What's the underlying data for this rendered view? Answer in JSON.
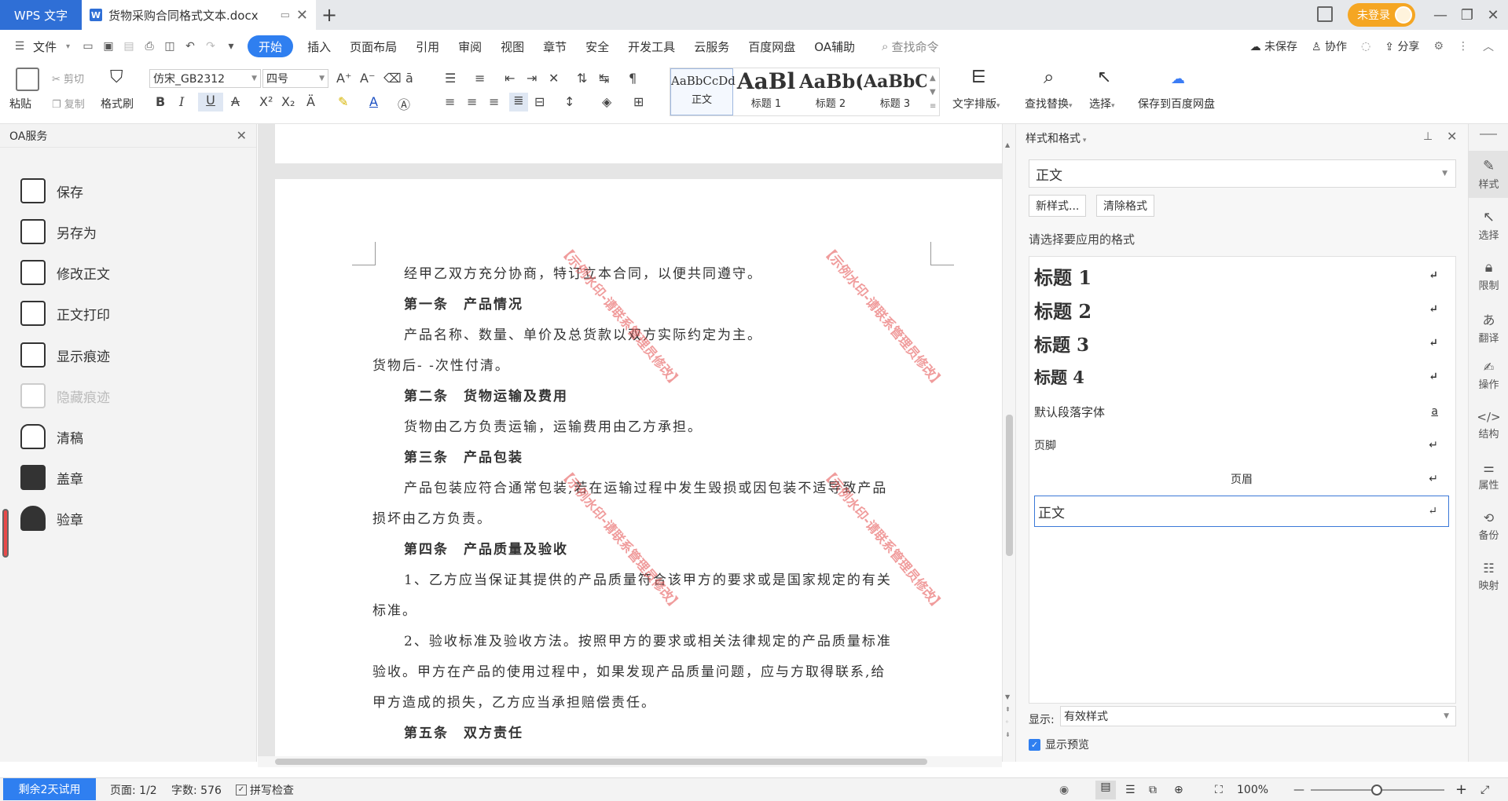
{
  "titlebar": {
    "app_name": "WPS 文字",
    "doc_tab": "货物采购合同格式文本.docx",
    "login": "未登录",
    "doc_icon_letter": "W"
  },
  "menu": {
    "file": "文件",
    "tabs": [
      "开始",
      "插入",
      "页面布局",
      "引用",
      "审阅",
      "视图",
      "章节",
      "安全",
      "开发工具",
      "云服务",
      "百度网盘",
      "OA辅助"
    ],
    "search_placeholder": "查找命令",
    "unsaved": "未保存",
    "collab": "协作",
    "share": "分享"
  },
  "ribbon": {
    "paste": "粘贴",
    "cut": "剪切",
    "copy": "复制",
    "format_painter": "格式刷",
    "font_name": "仿宋_GB2312",
    "font_size": "四号",
    "style_gallery": [
      {
        "preview": "AaBbCcDd",
        "label": "正文"
      },
      {
        "preview": "AaBl",
        "label": "标题 1"
      },
      {
        "preview": "AaBb(",
        "label": "标题 2"
      },
      {
        "preview": "AaBbC",
        "label": "标题 3"
      }
    ],
    "text_layout": "文字排版",
    "find_replace": "查找替换",
    "select": "选择",
    "save_baidu": "保存到百度网盘"
  },
  "oa_panel": {
    "title": "OA服务",
    "items": [
      {
        "label": "保存",
        "disabled": false
      },
      {
        "label": "另存为",
        "disabled": false
      },
      {
        "label": "修改正文",
        "disabled": false
      },
      {
        "label": "正文打印",
        "disabled": false
      },
      {
        "label": "显示痕迹",
        "disabled": false
      },
      {
        "label": "隐藏痕迹",
        "disabled": true
      },
      {
        "label": "清稿",
        "disabled": false
      },
      {
        "label": "盖章",
        "disabled": false
      },
      {
        "label": "验章",
        "disabled": false
      }
    ]
  },
  "document": {
    "lines": [
      {
        "text": "经甲乙双方充分协商，特订立本合同，以便共同遵守。",
        "bold": false,
        "indent": true
      },
      {
        "text": "第一条　产品情况",
        "bold": true,
        "indent": true
      },
      {
        "text": "产品名称、数量、单价及总货款以双方实际约定为主。",
        "bold": false,
        "indent": true
      },
      {
        "text": "货物后- -次性付清。",
        "bold": false,
        "indent": false
      },
      {
        "text": "第二条　货物运输及费用",
        "bold": true,
        "indent": true
      },
      {
        "text": "货物由乙方负责运输，运输费用由乙方承担。",
        "bold": false,
        "indent": true
      },
      {
        "text": "第三条　产品包装",
        "bold": true,
        "indent": true
      },
      {
        "text": "产品包装应符合通常包装,若在运输过程中发生毁损或因包装不适导致产品",
        "bold": false,
        "indent": true
      },
      {
        "text": "损坏由乙方负责。",
        "bold": false,
        "indent": false
      },
      {
        "text": "第四条　产品质量及验收",
        "bold": true,
        "indent": true
      },
      {
        "text": "1、乙方应当保证其提供的产品质量符合该甲方的要求或是国家规定的有关",
        "bold": false,
        "indent": true
      },
      {
        "text": "标准。",
        "bold": false,
        "indent": false
      },
      {
        "text": "2、验收标准及验收方法。按照甲方的要求或相关法律规定的产品质量标准",
        "bold": false,
        "indent": true
      },
      {
        "text": "验收。甲方在产品的使用过程中，如果发现产品质量问题，应与方取得联系,给",
        "bold": false,
        "indent": false
      },
      {
        "text": "甲方造成的损失，乙方应当承担赔偿责任。",
        "bold": false,
        "indent": false
      },
      {
        "text": "第五条　双方责任",
        "bold": true,
        "indent": true
      }
    ],
    "watermarks": [
      "【示例水印-请联系管理员修改】",
      "【示例水印-请联系管理员修改】",
      "【示例水印-请联系管理员修改】",
      "【示例水印-请联系管理员修改】"
    ]
  },
  "style_panel": {
    "title": "样式和格式",
    "current_style": "正文",
    "new_style": "新样式...",
    "clear_format": "清除格式",
    "prompt": "请选择要应用的格式",
    "styles": [
      {
        "name": "标题  1",
        "mark": "↵"
      },
      {
        "name": "标题  2",
        "mark": "↵"
      },
      {
        "name": "标题  3",
        "mark": "↵"
      },
      {
        "name": "标题  4",
        "mark": "↵"
      },
      {
        "name": "默认段落字体",
        "mark": "a"
      },
      {
        "name": "页脚",
        "mark": "↵"
      },
      {
        "name": "页眉",
        "mark": "↵"
      },
      {
        "name": "正文",
        "mark": "↵"
      }
    ],
    "show_label": "显示:",
    "show_value": "有效样式",
    "preview_label": "显示预览"
  },
  "right_sidebar": [
    "样式",
    "选择",
    "限制",
    "翻译",
    "操作",
    "结构",
    "属性",
    "备份",
    "映射"
  ],
  "statusbar": {
    "trial": "剩余2天试用",
    "page": "页面: 1/2",
    "words": "字数: 576",
    "spell": "拼写检查",
    "zoom": "100%"
  },
  "colors": {
    "accent": "#2f7ff0",
    "app_tab": "#2f6fd6",
    "login": "#f5a623",
    "watermark": "#e65a5a"
  }
}
